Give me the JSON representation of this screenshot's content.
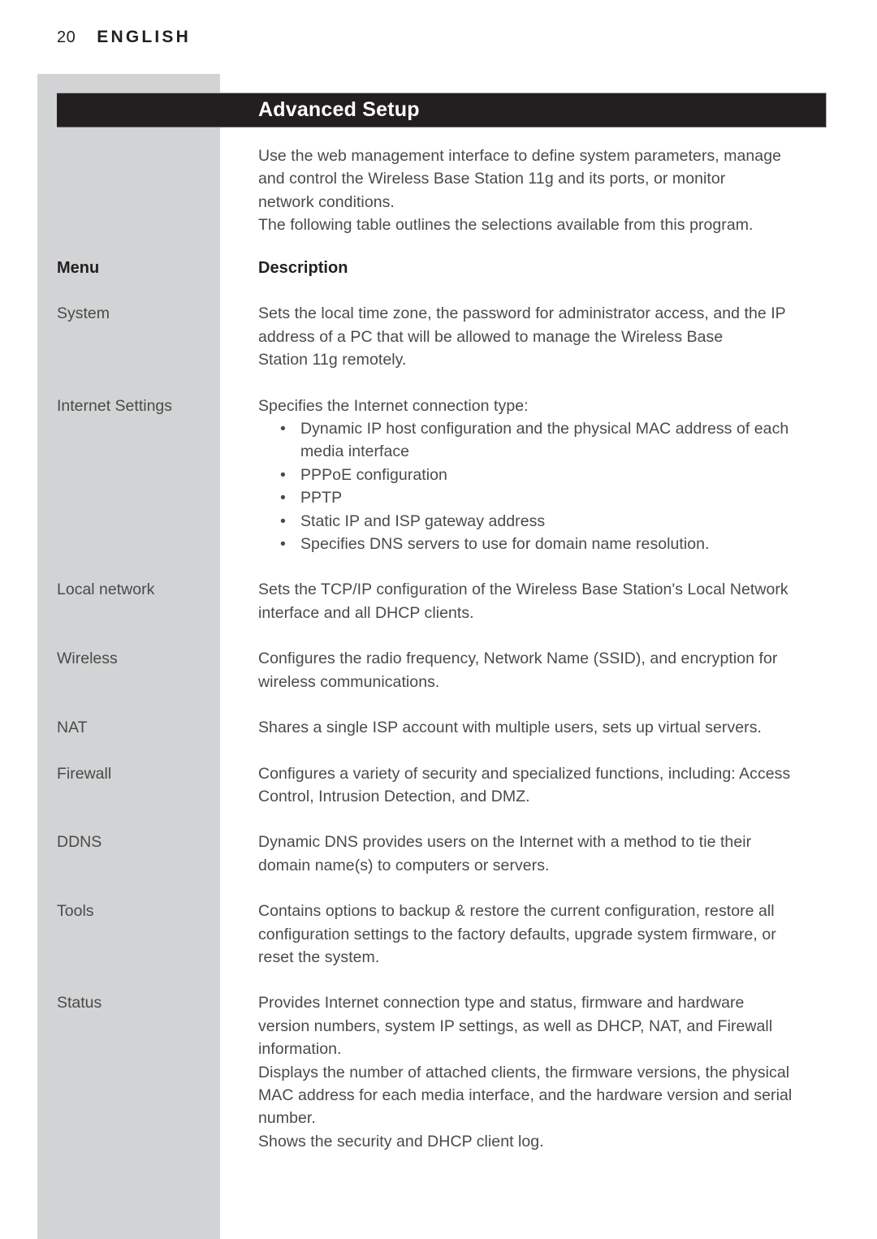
{
  "page": {
    "number": "20",
    "section": "ENGLISH"
  },
  "title_bar": {
    "title": "Advanced Setup"
  },
  "intro": {
    "line1": "Use the web management interface to define system parameters, manage",
    "line2": "and control the Wireless Base Station 11g and its ports, or monitor",
    "line3": "network conditions.",
    "line4": "The following table outlines the selections available from this program."
  },
  "table": {
    "headers": {
      "menu": "Menu",
      "description": "Description"
    },
    "rows": [
      {
        "menu": "System",
        "lines": [
          "Sets the local time zone, the password for administrator access, and the IP",
          "address of a PC that will be allowed to manage the Wireless Base",
          "Station 11g remotely."
        ]
      },
      {
        "menu": "Internet Settings",
        "lines": [
          "Specifies the Internet connection type:"
        ],
        "bullets": [
          "Dynamic IP host configuration and the physical MAC address of each media interface",
          "PPPoE configuration",
          "PPTP",
          "Static IP and ISP gateway address",
          "Specifies DNS servers to use for domain name resolution."
        ]
      },
      {
        "menu": "Local network",
        "lines": [
          "Sets the TCP/IP configuration of the Wireless Base Station's Local Network",
          "interface and all DHCP clients."
        ]
      },
      {
        "menu": "Wireless",
        "lines": [
          "Configures the radio frequency, Network Name (SSID), and encryption for",
          "wireless communications."
        ]
      },
      {
        "menu": "NAT",
        "lines": [
          "Shares a single ISP account with multiple users, sets up virtual servers."
        ]
      },
      {
        "menu": "Firewall",
        "lines": [
          "Configures a variety of security and specialized functions, including: Access",
          "Control, Intrusion Detection, and DMZ."
        ]
      },
      {
        "menu": "DDNS",
        "lines": [
          "Dynamic DNS provides users on the Internet with a method to tie their",
          "domain name(s) to computers or servers."
        ]
      },
      {
        "menu": "Tools",
        "lines": [
          "Contains options to backup & restore the current configuration, restore all",
          "configuration settings to the factory defaults, upgrade system firmware, or",
          "reset the system."
        ]
      },
      {
        "menu": "Status",
        "lines": [
          "Provides Internet connection type and status, firmware and hardware",
          "version numbers, system IP settings, as well as DHCP, NAT, and Firewall",
          "information.",
          "Displays the number of attached clients, the firmware versions, the physical",
          "MAC address for each media interface, and the hardware version and serial",
          "number.",
          "Shows the security and DHCP client log."
        ]
      }
    ]
  },
  "bullet_glyph": "•"
}
